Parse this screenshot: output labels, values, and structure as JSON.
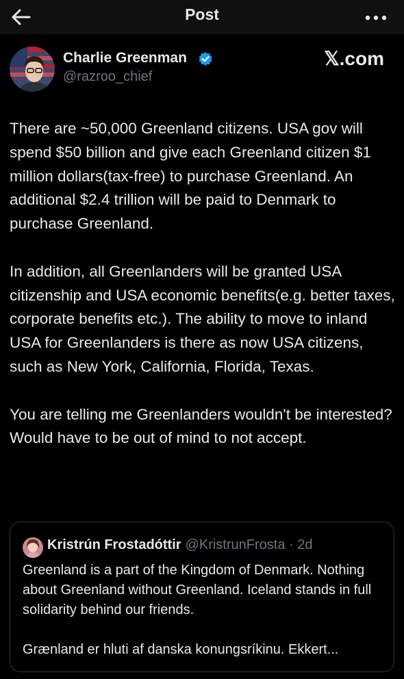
{
  "header": {
    "title": "Post",
    "back_icon": "arrow-left-icon",
    "more_icon": "more-horizontal-icon"
  },
  "post": {
    "author_name": "Charlie Greenman",
    "handle": "@razroo_chief",
    "verified_icon": "verified-badge-icon",
    "watermark": "𝕏.com",
    "paragraphs": [
      "There are ~50,000 Greenland citizens. USA gov will spend $50 billion and give each Greenland citizen $1 million dollars(tax-free) to purchase Greenland. An additional $2.4 trillion will be paid to Denmark to purchase Greenland.",
      "In addition, all Greenlanders will be granted USA citizenship and USA economic benefits(e.g. better taxes, corporate benefits etc.). The ability to move to inland USA for Greenlanders is there as now USA citizens, such as New York, California, Florida, Texas.",
      "You are telling me Greenlanders wouldn't be interested? Would have to be out of mind to not accept."
    ]
  },
  "quote": {
    "author_name": "Kristrún Frostadóttir",
    "meta": "@KristrunFrosta · 2d",
    "paragraphs": [
      "Greenland is a part of the Kingdom of Denmark. Nothing about Greenland without Greenland. Iceland stands in full solidarity behind our friends.",
      "Grænland er hluti af danska konungsríkinu. Ekkert..."
    ]
  },
  "colors": {
    "background": "#000000",
    "text": "#e7e9ea",
    "muted": "#71767b",
    "verified": "#1d9bf0",
    "border": "#2f3336"
  }
}
